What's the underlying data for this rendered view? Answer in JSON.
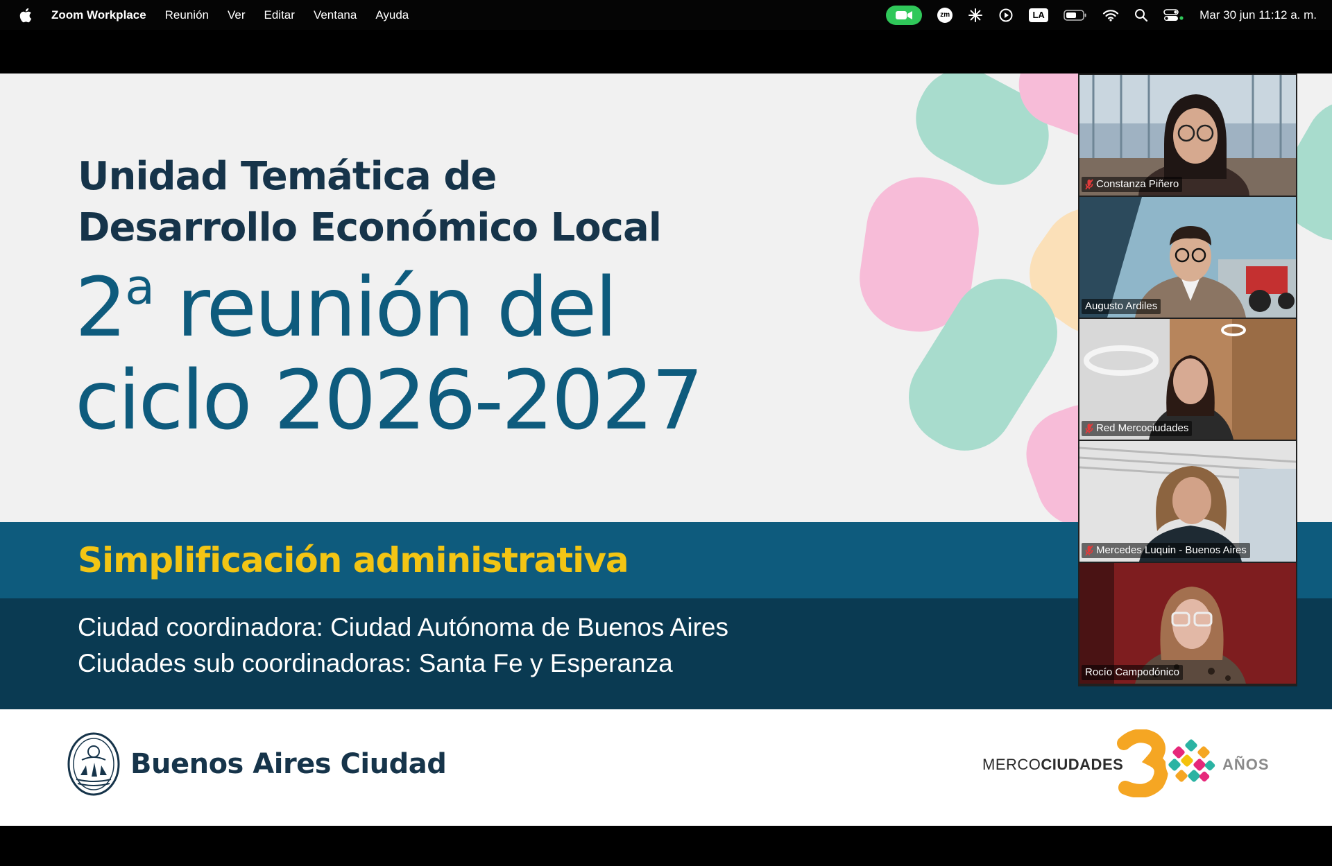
{
  "menubar": {
    "app_name": "Zoom Workplace",
    "menus": [
      "Reunión",
      "Ver",
      "Editar",
      "Ventana",
      "Ayuda"
    ],
    "status_icons": [
      "zoom-camera-icon",
      "zoom-badge-icon",
      "sparkle-icon",
      "play-circle-icon",
      "keyboard-layout-icon",
      "battery-icon",
      "wifi-icon",
      "search-icon",
      "control-center-icon"
    ],
    "zoom_badge": "zm",
    "keyboard_layout": "LA",
    "clock": "Mar 30 jun  11:12 a. m."
  },
  "slide": {
    "title_line1": "Unidad Temática de",
    "title_line2": "Desarrollo Económico Local",
    "meeting_number": "2",
    "meeting_ordinal": "a",
    "meeting_line1_rest": " reunión del",
    "meeting_line2": "ciclo 2026-2027",
    "subject": "Simplificación administrativa",
    "coordinating_city": "Ciudad coordinadora: Ciudad Autónoma de Buenos Aires",
    "sub_coordinating_cities": "Ciudades sub coordinadoras: Santa Fe y Esperanza",
    "footer_left_logo": "Buenos Aires Ciudad",
    "footer_right_prefix": "MERCO",
    "footer_right_bold": "CIUDADES",
    "footer_right_years": "AÑOS",
    "colors": {
      "dark_navy": "#16344a",
      "teal": "#0e5b7d",
      "deep_teal": "#0a3a52",
      "yellow": "#f3c514",
      "mint": "#a8dccd",
      "pink": "#f7bcd8",
      "peach": "#fbe0b8"
    }
  },
  "participants": [
    {
      "name": "Constanza Piñero",
      "muted": true,
      "speaking": false
    },
    {
      "name": "Augusto Ardiles",
      "muted": false,
      "speaking": false
    },
    {
      "name": "Red Mercociudades",
      "muted": true,
      "speaking": false
    },
    {
      "name": "Mercedes Luquin - Buenos Aires",
      "muted": true,
      "speaking": false
    },
    {
      "name": "Rocío Campodónico",
      "muted": false,
      "speaking": true
    }
  ]
}
